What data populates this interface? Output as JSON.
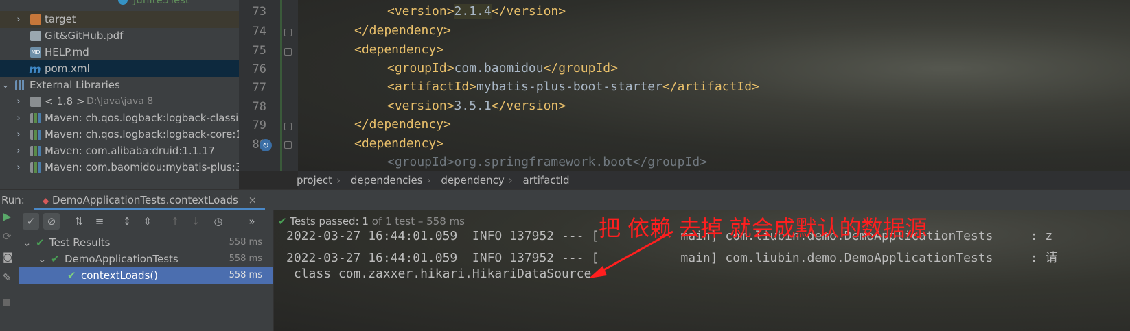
{
  "project_tree": {
    "partial_top_item": "Junite5Test",
    "items": [
      {
        "label": "target",
        "kind": "folder",
        "expandable": true
      },
      {
        "label": "Git&GitHub.pdf",
        "kind": "pdf"
      },
      {
        "label": "HELP.md",
        "kind": "md"
      },
      {
        "label": "pom.xml",
        "kind": "maven",
        "selected": true
      },
      {
        "label": "External Libraries",
        "kind": "libraries",
        "expanded": true
      },
      {
        "label": "< 1.8 >",
        "suffix": "D:\\Java\\java 8",
        "kind": "jdk",
        "expandable": true
      },
      {
        "label": "Maven: ch.qos.logback:logback-classic",
        "kind": "lib",
        "expandable": true
      },
      {
        "label": "Maven: ch.qos.logback:logback-core:1",
        "kind": "lib",
        "expandable": true
      },
      {
        "label": "Maven: com.alibaba:druid:1.1.17",
        "kind": "lib",
        "expandable": true
      },
      {
        "label": "Maven: com.baomidou:mybatis-plus:3.",
        "kind": "lib",
        "expandable": true
      }
    ]
  },
  "editor": {
    "lines": [
      {
        "num": "73",
        "indent": 2,
        "open": "<version>",
        "text": "2.1.4",
        "close": "</version>",
        "highlight": true
      },
      {
        "num": "74",
        "indent": 1,
        "open": "</dependency>",
        "text": "",
        "close": ""
      },
      {
        "num": "75",
        "indent": 1,
        "open": "<dependency>",
        "text": "",
        "close": ""
      },
      {
        "num": "76",
        "indent": 2,
        "open": "<groupId>",
        "text": "com.baomidou",
        "close": "</groupId>"
      },
      {
        "num": "77",
        "indent": 2,
        "open": "<artifactId>",
        "text": "mybatis-plus-boot-starter",
        "close": "</artifactId>"
      },
      {
        "num": "78",
        "indent": 2,
        "open": "<version>",
        "text": "3.5.1",
        "close": "</version>"
      },
      {
        "num": "79",
        "indent": 1,
        "open": "</dependency>",
        "text": "",
        "close": ""
      },
      {
        "num": "80",
        "indent": 1,
        "open": "<dependency>",
        "text": "",
        "close": ""
      }
    ],
    "partial_line": "<groupId>org.springframework.boot</groupId>"
  },
  "breadcrumbs": [
    "project",
    "dependencies",
    "dependency",
    "artifactId"
  ],
  "run": {
    "label": "Run:",
    "tab": "DemoApplicationTests.contextLoads",
    "status": "Tests passed:",
    "status_count": "1",
    "status_rest": "of 1 test – 558 ms",
    "tree": [
      {
        "label": "Test Results",
        "time": "558 ms",
        "depth": 0
      },
      {
        "label": "DemoApplicationTests",
        "time": "558 ms",
        "depth": 1
      },
      {
        "label": "contextLoads()",
        "time": "558 ms",
        "depth": 2,
        "selected": true
      }
    ],
    "console": [
      "2022-03-27 16:44:01.059  INFO 137952 --- [           main] com.liubin.demo.DemoApplicationTests     : z",
      "2022-03-27 16:44:01.059  INFO 137952 --- [           main] com.liubin.demo.DemoApplicationTests     : 请",
      " class com.zaxxer.hikari.HikariDataSource"
    ]
  },
  "annotation": "把 依赖 去掉 就会成默认的数据源",
  "colors": {
    "tag": "#e8bf6a",
    "selection": "#0d293e",
    "test_selected": "#4b6eaf",
    "annotation": "#ff1f1f",
    "pass": "#499c54"
  }
}
